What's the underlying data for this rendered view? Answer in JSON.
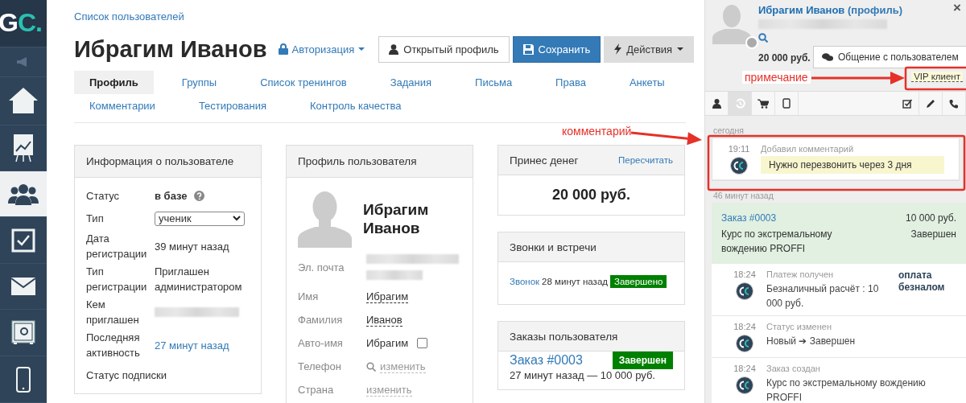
{
  "sidebar": {
    "logo": {
      "letter": "G",
      "accent": "C."
    },
    "items": [
      {
        "kind": "megaphone",
        "selected": false
      },
      {
        "kind": "home",
        "selected": false
      },
      {
        "kind": "chart",
        "selected": false
      },
      {
        "kind": "users",
        "selected": true
      },
      {
        "kind": "check",
        "selected": false
      },
      {
        "kind": "mail",
        "selected": false
      },
      {
        "kind": "safe",
        "selected": false
      },
      {
        "kind": "phone",
        "selected": false
      }
    ]
  },
  "main": {
    "breadcrumb": "Список пользователей",
    "title": "Ибрагим Иванов",
    "auth_menu": "Авторизация",
    "buttons": [
      {
        "kind": "profile",
        "label": "Открытый профиль"
      },
      {
        "kind": "save",
        "label": "Сохранить"
      },
      {
        "kind": "actions",
        "label": "Действия"
      }
    ],
    "tabs": [
      {
        "label": "Профиль",
        "selected": true
      },
      {
        "label": "Группы",
        "selected": false
      },
      {
        "label": "Список тренингов",
        "selected": false
      },
      {
        "label": "Задания",
        "selected": false
      },
      {
        "label": "Письма",
        "selected": false
      },
      {
        "label": "Права",
        "selected": false
      },
      {
        "label": "Анкеты",
        "selected": false
      },
      {
        "label": "Комментарии",
        "selected": false
      },
      {
        "label": "Тестирования",
        "selected": false
      },
      {
        "label": "Контроль качества",
        "selected": false
      }
    ],
    "info_card": {
      "title": "Информация о пользователе",
      "rows": [
        {
          "kind": "status",
          "label": "Статус",
          "value": "в базе"
        },
        {
          "kind": "select",
          "label": "Тип",
          "value": "ученик"
        },
        {
          "kind": "text",
          "label": "Дата регистрации",
          "value": "39 минут назад"
        },
        {
          "kind": "text",
          "label": "Тип регистрации",
          "value": "Приглашен администратором"
        },
        {
          "kind": "blurred",
          "label": "Кем приглашен"
        },
        {
          "kind": "link",
          "label": "Последняя активность",
          "value": "27 минут назад"
        },
        {
          "kind": "heading",
          "label": "Статус подписки"
        }
      ]
    },
    "profile_card": {
      "title": "Профиль пользователя",
      "name": "Ибрагим Иванов",
      "fields": [
        {
          "kind": "blurred",
          "label": "Эл. почта"
        },
        {
          "kind": "editable",
          "label": "Имя",
          "value": "Ибрагим"
        },
        {
          "kind": "editable",
          "label": "Фамилия",
          "value": "Иванов"
        },
        {
          "kind": "auto",
          "label": "Авто-имя",
          "value": "Ибрагим",
          "checked": false
        },
        {
          "kind": "search-link",
          "label": "Телефон",
          "value": "изменить"
        },
        {
          "kind": "link",
          "label": "Страна",
          "value": "изменить"
        }
      ]
    },
    "money_card": {
      "title": "Принес денег",
      "action": "Пересчитать",
      "amount": "20 000 руб."
    },
    "calls_card": {
      "title": "Звонки и встречи",
      "calls": [
        {
          "link": "Звонок",
          "time": "28 минут назад",
          "status": "Завершено"
        }
      ]
    },
    "orders_card": {
      "title": "Заказы пользователя",
      "orders": [
        {
          "number": "Заказ #0003",
          "status": "Завершен",
          "meta": "27 минут назад — 10 000 руб."
        }
      ]
    }
  },
  "panel": {
    "name": "Ибрагим Иванов",
    "profile_link": "(профиль)",
    "online": false,
    "balance": "20 000 руб.",
    "chat_button": "Общение с пользователем",
    "close": "×",
    "note": "VIP клиент",
    "tabs": [
      {
        "kind": "user",
        "selected": false
      },
      {
        "kind": "history",
        "selected": true
      },
      {
        "kind": "cart",
        "selected": false
      },
      {
        "kind": "tablet",
        "selected": false
      },
      {
        "kind": "tasks",
        "selected": false
      },
      {
        "kind": "pencil",
        "selected": false
      },
      {
        "kind": "phone",
        "selected": false
      }
    ],
    "feed": [
      {
        "date": "сегодня",
        "events": [
          {
            "kind": "comment",
            "time": "19:11",
            "title": "Добавил комментарий",
            "text": "Нужно перезвонить через 3 дня"
          }
        ]
      },
      {
        "date": "46 минут назад",
        "order": {
          "number": "Заказ #0003",
          "amount": "10 000 руб.",
          "description": "Курс по экстремальному вождению PROFFI",
          "status": "Завершен"
        },
        "events": [
          {
            "kind": "payment",
            "time": "18:24",
            "title": "Платеж получен",
            "text": "Безналичный расчёт : 10 000 руб.",
            "tag": "оплата безналом"
          },
          {
            "kind": "status",
            "time": "18:24",
            "title": "Статус изменен",
            "text": "Новый ➔ Завершен"
          },
          {
            "kind": "created",
            "time": "18:24",
            "title": "Заказ создан",
            "text": "Курс по экстремальному вождению PROFFI"
          }
        ]
      }
    ]
  },
  "annotations": [
    {
      "kind": "note",
      "label": "примечание"
    },
    {
      "kind": "comment",
      "label": "комментарий"
    }
  ]
}
